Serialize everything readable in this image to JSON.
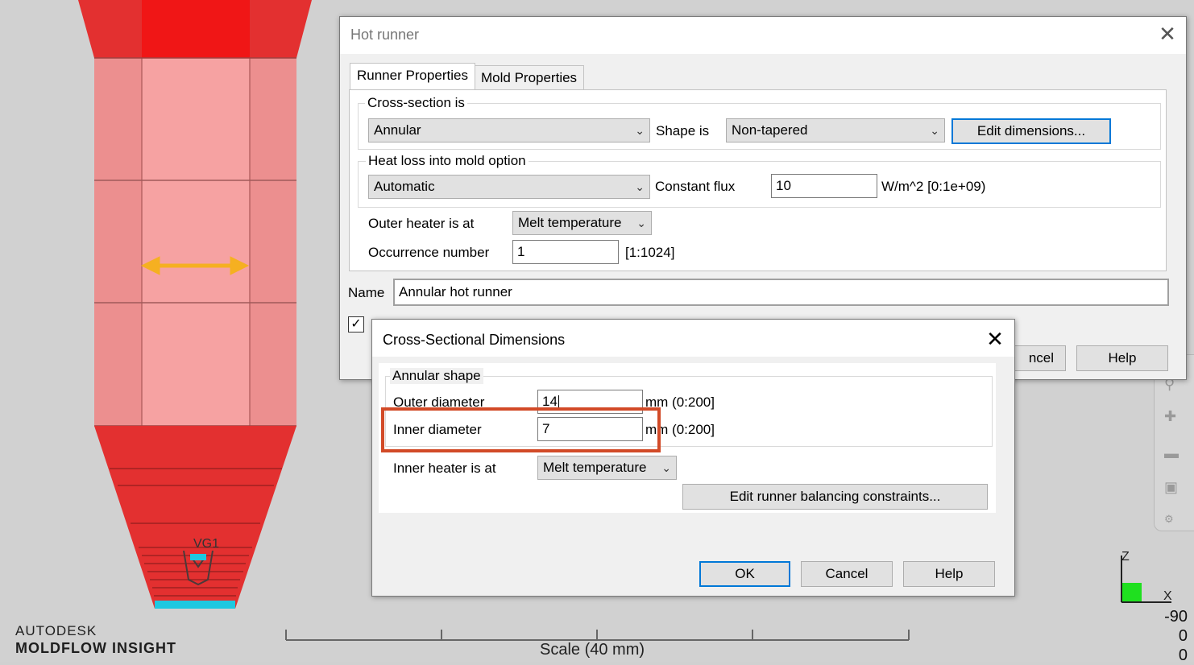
{
  "brand": {
    "line1": "AUTODESK",
    "line2": "MOLDFLOW INSIGHT"
  },
  "viewport": {
    "gate_label": "VG1",
    "scale_label": "Scale (40 mm)",
    "axis_z": "Z",
    "axis_x": "X",
    "rotation": [
      "-90",
      "0",
      "0"
    ]
  },
  "hot_runner": {
    "title": "Hot runner",
    "tabs": [
      "Runner Properties",
      "Mold Properties"
    ],
    "cross_section_group": "Cross-section is",
    "cross_section_value": "Annular",
    "shape_label": "Shape is",
    "shape_value": "Non-tapered",
    "edit_dimensions": "Edit dimensions...",
    "heat_loss_group": "Heat loss into mold option",
    "heat_loss_value": "Automatic",
    "constant_flux_label": "Constant flux",
    "constant_flux_value": "10",
    "constant_flux_unit": "W/m^2 [0:1e+09)",
    "outer_heater_label": "Outer heater is at",
    "outer_heater_value": "Melt temperature",
    "occurrence_label": "Occurrence number",
    "occurrence_value": "1",
    "occurrence_range": "[1:1024]",
    "name_label": "Name",
    "name_value": "Annular hot runner",
    "cancel_label": "ncel",
    "help_label": "Help"
  },
  "cross_dims": {
    "title": "Cross-Sectional Dimensions",
    "group_label": "Annular shape",
    "outer_label": "Outer diameter",
    "outer_value": "14",
    "outer_unit": "mm (0:200]",
    "inner_label": "Inner diameter",
    "inner_value": "7",
    "inner_unit": "mm (0:200]",
    "inner_heater_label": "Inner heater is at",
    "inner_heater_value": "Melt temperature",
    "balancing_button": "Edit runner balancing constraints...",
    "ok": "OK",
    "cancel": "Cancel",
    "help": "Help"
  },
  "colors": {
    "runner_dark": "#e12a2a",
    "runner_bright": "#f01616",
    "runner_light": "#f29a9a",
    "arrow": "#f5b021",
    "gate_cyan": "#1ec8e0",
    "highlight": "#d24a27",
    "accent": "#0078d7"
  }
}
